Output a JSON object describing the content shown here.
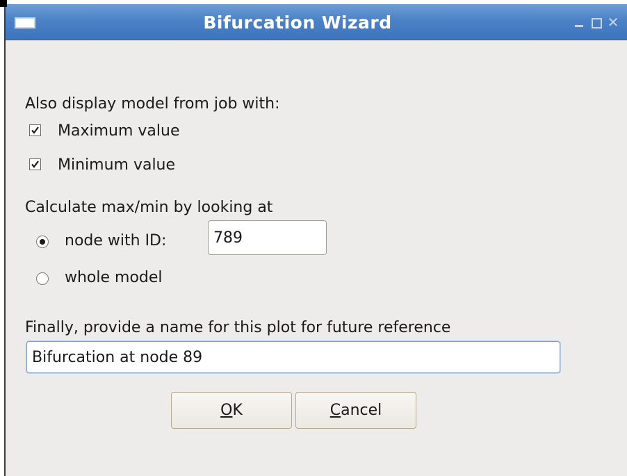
{
  "window": {
    "title": "Bifurcation Wizard"
  },
  "display_section": {
    "heading": "Also display model from job with:",
    "options": [
      {
        "label": "Maximum value",
        "checked": true
      },
      {
        "label": "Minimum value",
        "checked": true
      }
    ]
  },
  "calc_section": {
    "heading": "Calculate max/min by looking at",
    "options": [
      {
        "label": "node with ID:",
        "selected": true
      },
      {
        "label": "whole model",
        "selected": false
      }
    ],
    "node_id_value": "789"
  },
  "name_section": {
    "heading": "Finally, provide a name for this plot for future reference",
    "plot_name_value": "Bifurcation at node 89"
  },
  "buttons": {
    "ok": {
      "mnemonic": "O",
      "rest": "K"
    },
    "cancel": {
      "mnemonic": "C",
      "rest": "ancel"
    }
  },
  "icons": {
    "window_menu": "window-menu-icon",
    "minimize": "minimize-icon",
    "maximize": "maximize-icon",
    "close": "close-icon",
    "check": "checkmark-icon"
  }
}
